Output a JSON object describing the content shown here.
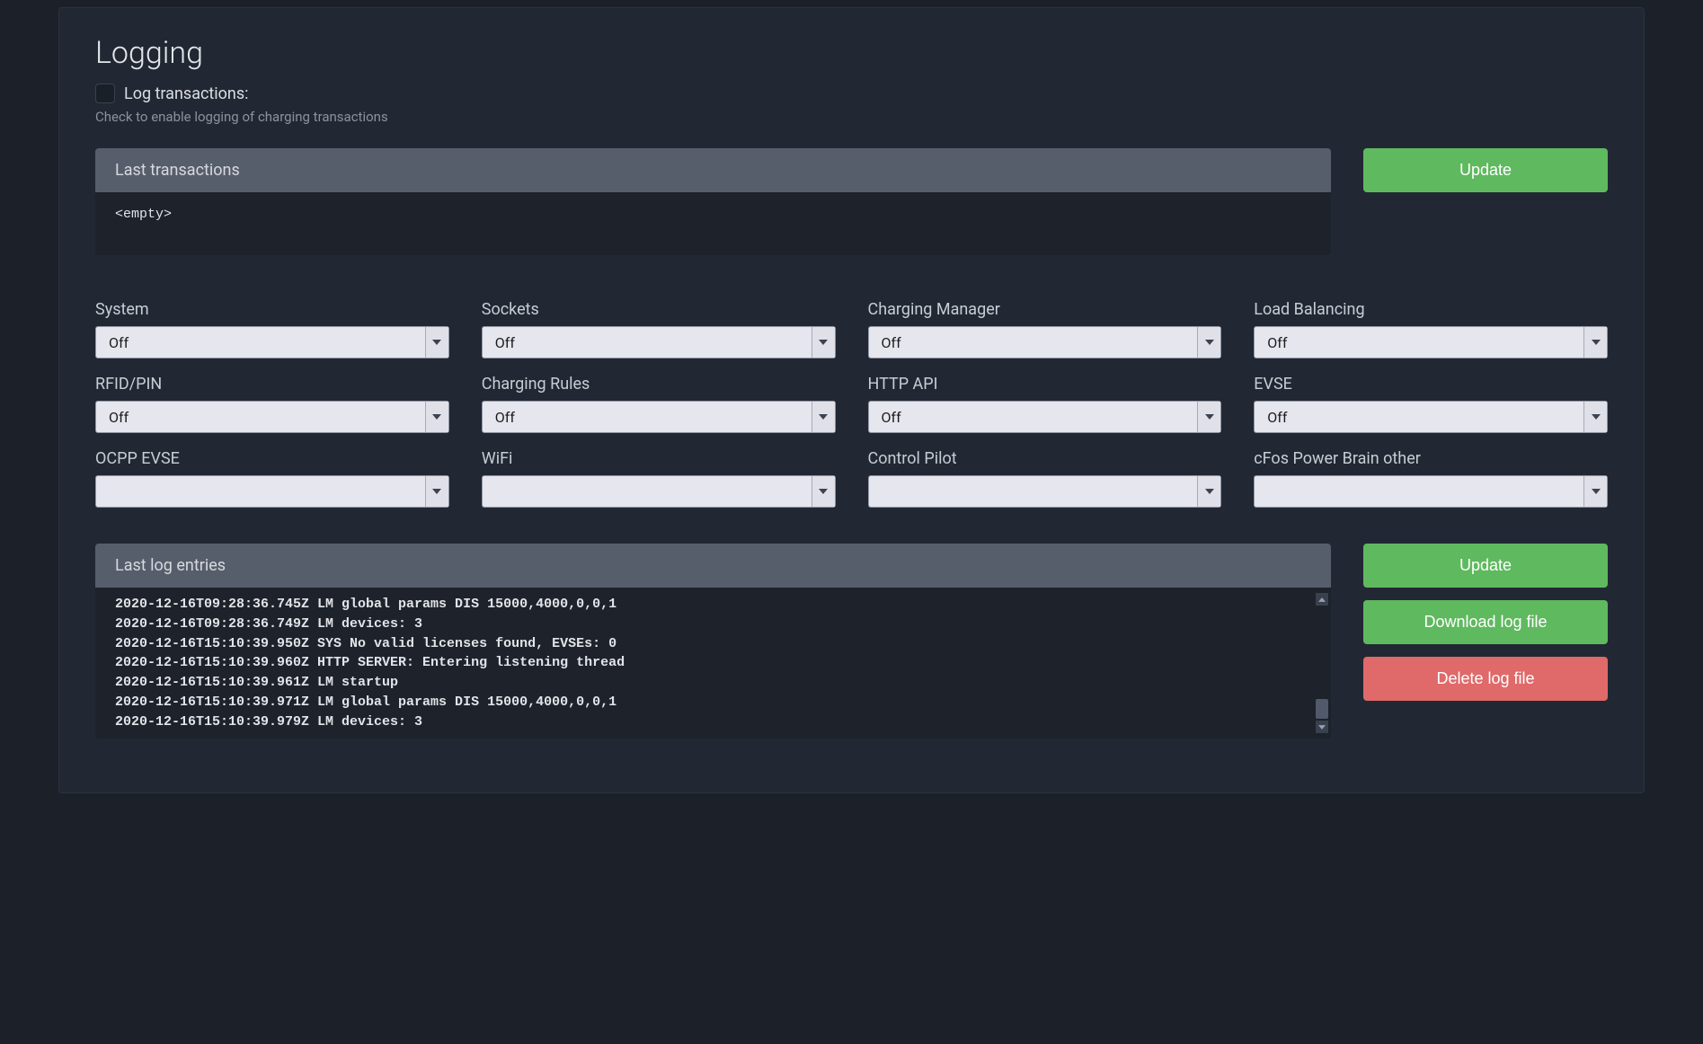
{
  "page_title": "Logging",
  "log_transactions": {
    "label": "Log transactions:",
    "checked": false,
    "hint": "Check to enable logging of charging transactions"
  },
  "last_transactions": {
    "header": "Last transactions",
    "body": "<empty>"
  },
  "buttons": {
    "update_transactions": "Update",
    "update_log": "Update",
    "download_log": "Download log file",
    "delete_log": "Delete log file"
  },
  "selects": [
    {
      "label": "System",
      "value": "Off"
    },
    {
      "label": "Sockets",
      "value": "Off"
    },
    {
      "label": "Charging Manager",
      "value": "Off"
    },
    {
      "label": "Load Balancing",
      "value": "Off"
    },
    {
      "label": "RFID/PIN",
      "value": "Off"
    },
    {
      "label": "Charging Rules",
      "value": "Off"
    },
    {
      "label": "HTTP API",
      "value": "Off"
    },
    {
      "label": "EVSE",
      "value": "Off"
    },
    {
      "label": "OCPP EVSE",
      "value": ""
    },
    {
      "label": "WiFi",
      "value": ""
    },
    {
      "label": "Control Pilot",
      "value": ""
    },
    {
      "label": "cFos Power Brain other",
      "value": ""
    }
  ],
  "last_log_entries": {
    "header": "Last log entries",
    "lines": [
      "2020-12-16T09:28:36.745Z LM global params DIS 15000,4000,0,0,1",
      "2020-12-16T09:28:36.749Z LM devices: 3",
      "2020-12-16T15:10:39.950Z SYS No valid licenses found, EVSEs: 0",
      "2020-12-16T15:10:39.960Z HTTP SERVER: Entering listening thread",
      "2020-12-16T15:10:39.961Z LM startup",
      "2020-12-16T15:10:39.971Z LM global params DIS 15000,4000,0,0,1",
      "2020-12-16T15:10:39.979Z LM devices: 3"
    ]
  }
}
